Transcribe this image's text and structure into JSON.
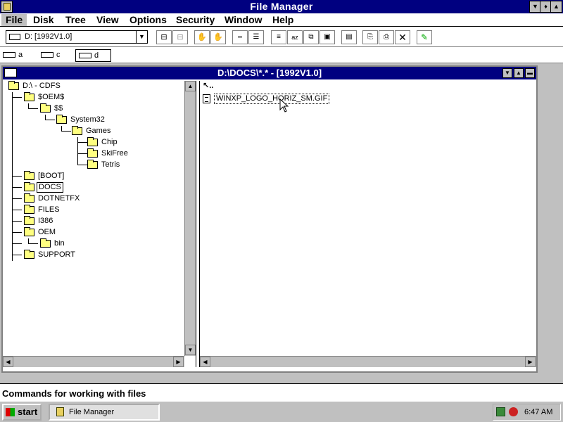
{
  "app": {
    "title": "File Manager"
  },
  "menu": {
    "items": [
      {
        "label": "File"
      },
      {
        "label": "Disk"
      },
      {
        "label": "Tree"
      },
      {
        "label": "View"
      },
      {
        "label": "Options"
      },
      {
        "label": "Security"
      },
      {
        "label": "Window"
      },
      {
        "label": "Help"
      }
    ]
  },
  "toolbar": {
    "drive_select_value": "D: [1992V1.0]"
  },
  "drives": [
    {
      "letter": "a"
    },
    {
      "letter": "c"
    },
    {
      "letter": "d"
    }
  ],
  "child": {
    "title": "D:\\DOCS\\*.* - [1992V1.0]",
    "tree": [
      {
        "label": "D:\\ - CDFS"
      },
      {
        "label": "$OEM$"
      },
      {
        "label": "$$"
      },
      {
        "label": "System32"
      },
      {
        "label": "Games"
      },
      {
        "label": "Chip"
      },
      {
        "label": "SkiFree"
      },
      {
        "label": "Tetris"
      },
      {
        "label": "[BOOT]"
      },
      {
        "label": "DOCS"
      },
      {
        "label": "DOTNETFX"
      },
      {
        "label": "FILES"
      },
      {
        "label": "I386"
      },
      {
        "label": "OEM"
      },
      {
        "label": "bin"
      },
      {
        "label": "SUPPORT"
      }
    ],
    "files": [
      {
        "name": "WINXP_LOGO_HORIZ_SM.GIF"
      }
    ]
  },
  "status": {
    "text": "Commands for working with files"
  },
  "taskbar": {
    "start_label": "start",
    "items": [
      {
        "label": "File Manager"
      }
    ],
    "clock": "6:47 AM"
  }
}
